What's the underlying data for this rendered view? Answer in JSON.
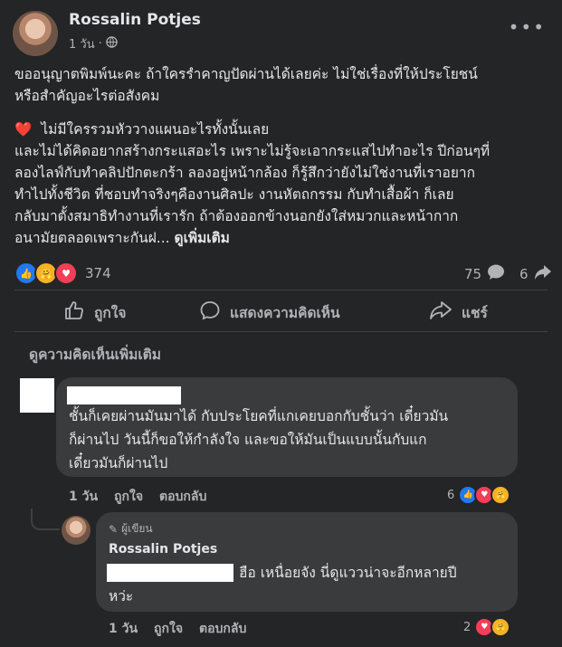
{
  "post": {
    "author": "Rossalin Potjes",
    "time": "1 วัน",
    "privacy_icon": "globe-icon",
    "paragraph1_line1": "ขออนุญาตพิมพ์นะคะ ถ้าใครรำคาญปัดผ่านได้เลยค่ะ ไม่ใช่เรื่องที่ให้ประโยชน์",
    "paragraph1_line2": "หรือสำคัญอะไรต่อสังคม",
    "heart_emoji": "❤️",
    "paragraph2_line1": "ไม่มีใครรวมหัววางแผนอะไรทั้งนั้นเลย",
    "paragraph2_line2": "และไม่ได้คิดอยากสร้างกระแสอะไร เพราะไม่รู้จะเอากระแสไปทำอะไร ปีก่อนๆที่",
    "paragraph2_line3": "ลองไลฟ์กับทำคลิปปักตะกร้า ลองอยู่หน้ากล้อง ก็รู้สึกว่ายังไม่ใช่งานที่เราอยาก",
    "paragraph2_line4": "ทำไปทั้งชีวิต ที่ชอบทำจริงๆคืองานศิลปะ งานหัตถกรรม กับทำเสื้อผ้า ก็เลย",
    "paragraph2_line5": "กลับมาตั้งสมาธิทำงานที่เรารัก ถ้าต้องออกข้างนอกยังใส่หมวกและหน้ากาก",
    "paragraph2_line6": "อนามัยตลอดเพราะกันฝ...",
    "see_more": "ดูเพิ่มเติม"
  },
  "stats": {
    "reaction_count": "374",
    "comment_count": "75",
    "share_count": "6"
  },
  "actions": {
    "like": "ถูกใจ",
    "comment": "แสดงความคิดเห็น",
    "share": "แชร์"
  },
  "comments": {
    "view_more": "ดูความคิดเห็นเพิ่มเติม",
    "first": {
      "line1": "ชั้นก็เคยผ่านมันมาได้ กับประโยคที่แกเคยบอกกับชั้นว่า เดี๋ยวมัน",
      "line2": "ก็ผ่านไป วันนี้ก็ขอให้กำลังใจ และขอให้มันเป็นแบบนั้นกับแก",
      "line3": "เดี๋ยวมันก็ผ่านไป",
      "time": "1 วัน",
      "like": "ถูกใจ",
      "reply": "ตอบกลับ",
      "reaction_count": "6"
    },
    "reply": {
      "badge": "ผู้เขียน",
      "author": "Rossalin Potjes",
      "line1": "ฮือ เหนื่อยจัง นี่ดูแววน่าจะอีกหลายปี",
      "line2": "หว่ะ",
      "time": "1 วัน",
      "like": "ถูกใจ",
      "reply": "ตอบกลับ",
      "reaction_count": "2"
    }
  },
  "colors": {
    "background": "#242526",
    "bubble": "#3a3b3c",
    "text": "#e4e6eb",
    "muted": "#b0b3b8",
    "like_blue": "#2078f4",
    "love_red": "#f33e58",
    "care_yellow": "#f7b125"
  }
}
